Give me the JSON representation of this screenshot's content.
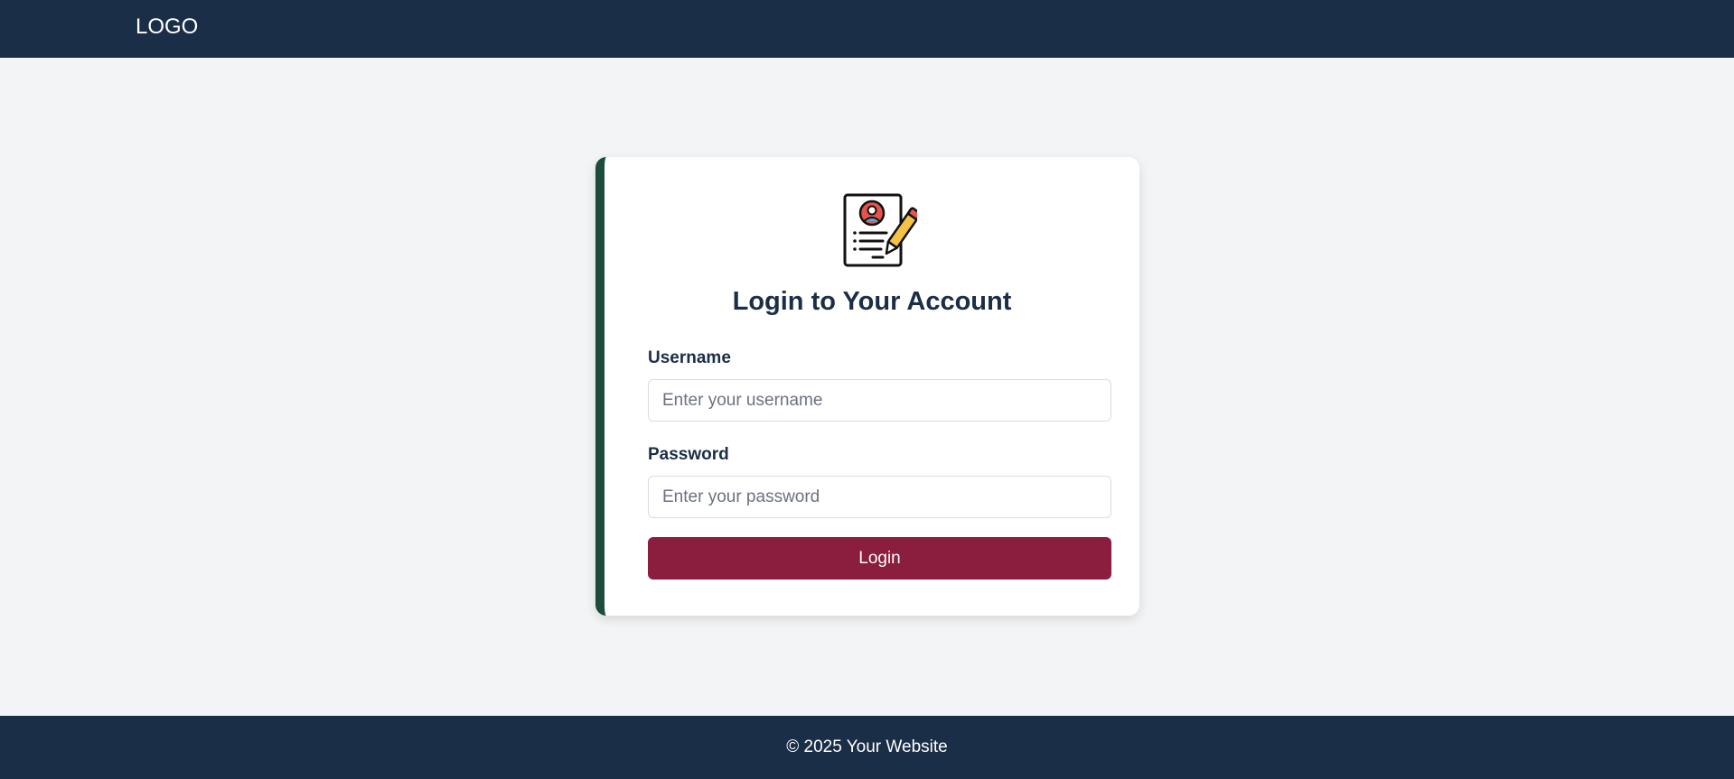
{
  "header": {
    "logo_text": "LOGO"
  },
  "login_card": {
    "icon": "document-user-pencil-icon",
    "title": "Login to Your Account",
    "username": {
      "label": "Username",
      "value": "",
      "placeholder": "Enter your username"
    },
    "password": {
      "label": "Password",
      "value": "",
      "placeholder": "Enter your password"
    },
    "submit_label": "Login"
  },
  "footer": {
    "text": "© 2025 Your Website"
  },
  "colors": {
    "navy": "#1b2e48",
    "card_accent_green": "#1d4d3a",
    "button_maroon": "#8b1d3f",
    "page_background": "#f3f4f6",
    "icon_red": "#e5534b",
    "icon_yellow": "#f6c244"
  }
}
